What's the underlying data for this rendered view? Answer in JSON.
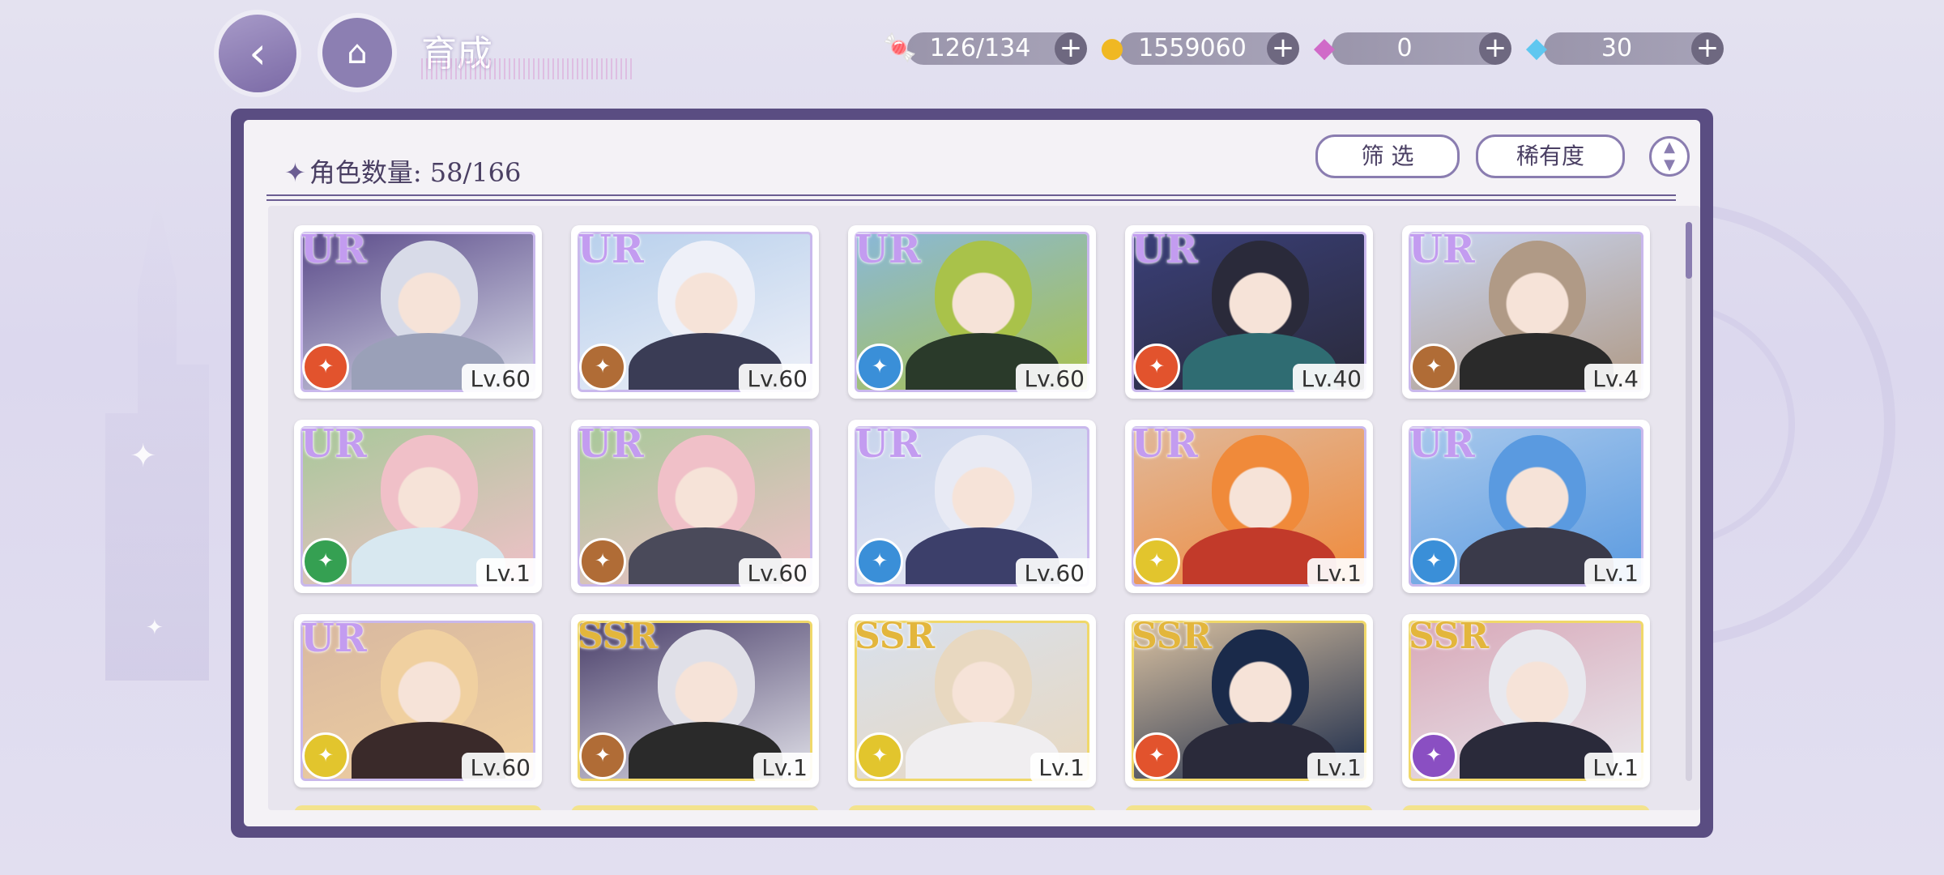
{
  "header": {
    "title": "育成",
    "back_icon": "back-arrow-icon",
    "home_icon": "castle-icon"
  },
  "resources": [
    {
      "name": "candy",
      "icon": "candy-icon",
      "value": "126/134"
    },
    {
      "name": "gold",
      "icon": "coin-icon",
      "value": "1559060"
    },
    {
      "name": "paid-gem",
      "icon": "rainbow-gem-icon",
      "value": "0"
    },
    {
      "name": "gem",
      "icon": "diamond-icon",
      "value": "30"
    }
  ],
  "panel": {
    "count_label": "角色数量: 58/166",
    "filter_label": "筛 选",
    "rarity_label": "稀有度"
  },
  "colors": {
    "frame": "#5a4d82",
    "ur": "#c39cf0",
    "ssr": "#e3b63c"
  },
  "cards": [
    {
      "rarity": "UR",
      "level": "Lv.60",
      "role": "red"
    },
    {
      "rarity": "UR",
      "level": "Lv.60",
      "role": "brown"
    },
    {
      "rarity": "UR",
      "level": "Lv.60",
      "role": "blue"
    },
    {
      "rarity": "UR",
      "level": "Lv.40",
      "role": "red"
    },
    {
      "rarity": "UR",
      "level": "Lv.4",
      "role": "brown"
    },
    {
      "rarity": "UR",
      "level": "Lv.1",
      "role": "green"
    },
    {
      "rarity": "UR",
      "level": "Lv.60",
      "role": "brown"
    },
    {
      "rarity": "UR",
      "level": "Lv.60",
      "role": "blue"
    },
    {
      "rarity": "UR",
      "level": "Lv.1",
      "role": "yellow"
    },
    {
      "rarity": "UR",
      "level": "Lv.1",
      "role": "blue"
    },
    {
      "rarity": "UR",
      "level": "Lv.60",
      "role": "yellow"
    },
    {
      "rarity": "SSR",
      "level": "Lv.1",
      "role": "brown"
    },
    {
      "rarity": "SSR",
      "level": "Lv.1",
      "role": "yellow"
    },
    {
      "rarity": "SSR",
      "level": "Lv.1",
      "role": "red"
    },
    {
      "rarity": "SSR",
      "level": "Lv.1",
      "role": "purple"
    }
  ]
}
